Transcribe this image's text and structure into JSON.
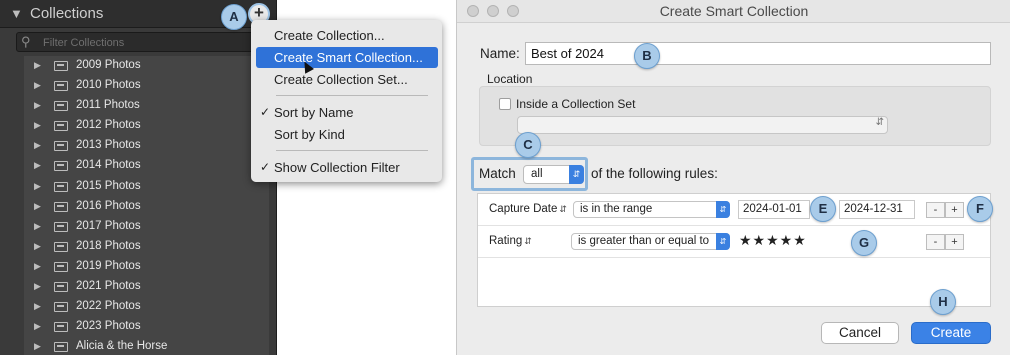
{
  "lightroom_panel": {
    "title": "Collections",
    "collapse_glyph": "▼",
    "add_glyph": "+",
    "filter_placeholder": "Filter Collections",
    "collections": [
      "2009 Photos",
      "2010 Photos",
      "2011 Photos",
      "2012 Photos",
      "2013 Photos",
      "2014 Photos",
      "2015 Photos",
      "2016 Photos",
      "2017 Photos",
      "2018 Photos",
      "2019 Photos",
      "2021 Photos",
      "2022 Photos",
      "2023 Photos",
      "Alicia & the Horse"
    ]
  },
  "menu": {
    "items": [
      {
        "label": "Create Collection...",
        "checked": false,
        "active": false
      },
      {
        "label": "Create Smart Collection...",
        "checked": false,
        "active": true
      },
      {
        "label": "Create Collection Set...",
        "checked": false,
        "active": false
      },
      {
        "label": "Sort by Name",
        "checked": true,
        "active": false
      },
      {
        "label": "Sort by Kind",
        "checked": false,
        "active": false
      },
      {
        "label": "Show Collection Filter",
        "checked": true,
        "active": false
      }
    ]
  },
  "dialog": {
    "title": "Create Smart Collection",
    "name_label": "Name:",
    "name_value": "Best of 2024",
    "location_label": "Location",
    "inside_set_label": "Inside a Collection Set",
    "inside_set_checked": false,
    "match_label": "Match",
    "match_value": "all",
    "match_suffix": "of the following rules:",
    "rules": [
      {
        "field": "Capture Date",
        "operator": "is in the range",
        "value_from": "2024-01-01",
        "value_to": "2024-12-31"
      },
      {
        "field": "Rating",
        "operator": "is greater than or equal to",
        "value_stars": "★★★★★"
      }
    ],
    "minus_label": "-",
    "plus_label": "+",
    "cancel_label": "Cancel",
    "create_label": "Create"
  },
  "callouts": [
    "A",
    "B",
    "C",
    "E",
    "F",
    "G",
    "H"
  ],
  "colors": {
    "accent": "#3b82e6",
    "callout_fill": "#a9cbe9",
    "panel_bg": "#3a3a3a"
  }
}
